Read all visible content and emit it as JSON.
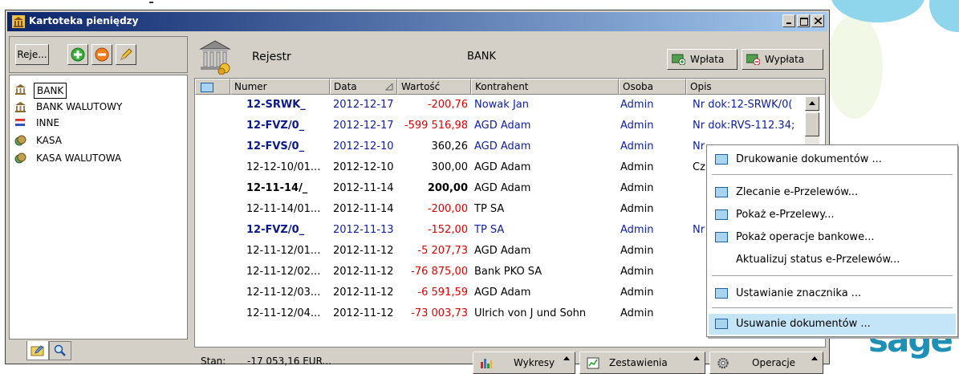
{
  "window": {
    "title": "Kartoteka pieniędzy"
  },
  "left": {
    "reje_label": "Reje...",
    "tree": [
      {
        "label": "BANK",
        "icon": "bank-icon",
        "selected": true
      },
      {
        "label": "BANK WALUTOWY",
        "icon": "bank-icon"
      },
      {
        "label": "INNE",
        "icon": "flag-icon"
      },
      {
        "label": "KASA",
        "icon": "cash-icon"
      },
      {
        "label": "KASA WALUTOWA",
        "icon": "cash-icon"
      }
    ]
  },
  "header": {
    "title": "Rejestr",
    "register_name": "BANK",
    "deposit_label": "Wpłata",
    "withdraw_label": "Wypłata"
  },
  "table": {
    "columns": [
      "Numer",
      "Data",
      "Wartość",
      "Kontrahent",
      "Osoba",
      "Opis"
    ],
    "rows": [
      {
        "numer": "12-SRWK_",
        "data": "2012-12-17",
        "wartosc": "-200,76",
        "kontrahent": "Nowak Jan",
        "osoba": "Admin",
        "opis": "Nr dok:12-SRWK/0("
      },
      {
        "numer": "12-FVZ/0_",
        "data": "2012-12-17",
        "wartosc": "-599 516,98",
        "kontrahent": "AGD Adam",
        "osoba": "Admin",
        "opis": "Nr dok:RVS-112.34;"
      },
      {
        "numer": "12-FVS/0_",
        "data": "2012-12-10",
        "wartosc": "360,26",
        "kontrahent": "AGD Adam",
        "osoba": "Admin",
        "opis": "Nr"
      },
      {
        "numer": "12-12-10/01...",
        "data": "2012-12-10",
        "wartosc": "300,00",
        "kontrahent": "AGD Adam",
        "osoba": "Admin",
        "opis": "Cz"
      },
      {
        "numer": "12-11-14/_",
        "data": "2012-11-14",
        "wartosc": "200,00",
        "kontrahent": "AGD Adam",
        "osoba": "Admin",
        "opis": ""
      },
      {
        "numer": "12-11-14/01...",
        "data": "2012-11-14",
        "wartosc": "-200,00",
        "kontrahent": "TP SA",
        "osoba": "Admin",
        "opis": ""
      },
      {
        "numer": "12-FVZ/0_",
        "data": "2012-11-13",
        "wartosc": "-152,00",
        "kontrahent": "TP SA",
        "osoba": "Admin",
        "opis": "Nr"
      },
      {
        "numer": "12-11-12/01...",
        "data": "2012-11-12",
        "wartosc": "-5 207,73",
        "kontrahent": "AGD Adam",
        "osoba": "Admin",
        "opis": ""
      },
      {
        "numer": "12-11-12/02...",
        "data": "2012-11-12",
        "wartosc": "-76 875,00",
        "kontrahent": "Bank PKO SA",
        "osoba": "Admin",
        "opis": ""
      },
      {
        "numer": "12-11-12/03...",
        "data": "2012-11-12",
        "wartosc": "-6 591,59",
        "kontrahent": "AGD Adam",
        "osoba": "Admin",
        "opis": ""
      },
      {
        "numer": "12-11-12/04...",
        "data": "2012-11-12",
        "wartosc": "-73 003,73",
        "kontrahent": "Ulrich von J und Sohn",
        "osoba": "Admin",
        "opis": ""
      }
    ]
  },
  "status": {
    "stan_label": "Stan:",
    "stan_value": "-17 053,16 EUR...",
    "charts_label": "Wykresy",
    "reports_label": "Zestawienia",
    "operations_label": "Operacje"
  },
  "menu": {
    "items": [
      {
        "label": "Drukowanie dokumentów ..."
      },
      {
        "label": "Zlecanie e-Przelewów..."
      },
      {
        "label": "Pokaż e-Przelewy..."
      },
      {
        "label": "Pokaż operacje bankowe..."
      },
      {
        "label": "Aktualizuj status e-Przelewów..."
      },
      {
        "label": "Ustawianie znacznika ..."
      },
      {
        "label": "Usuwanie dokumentów ..."
      }
    ]
  },
  "brand": {
    "logo_text": "sage"
  }
}
